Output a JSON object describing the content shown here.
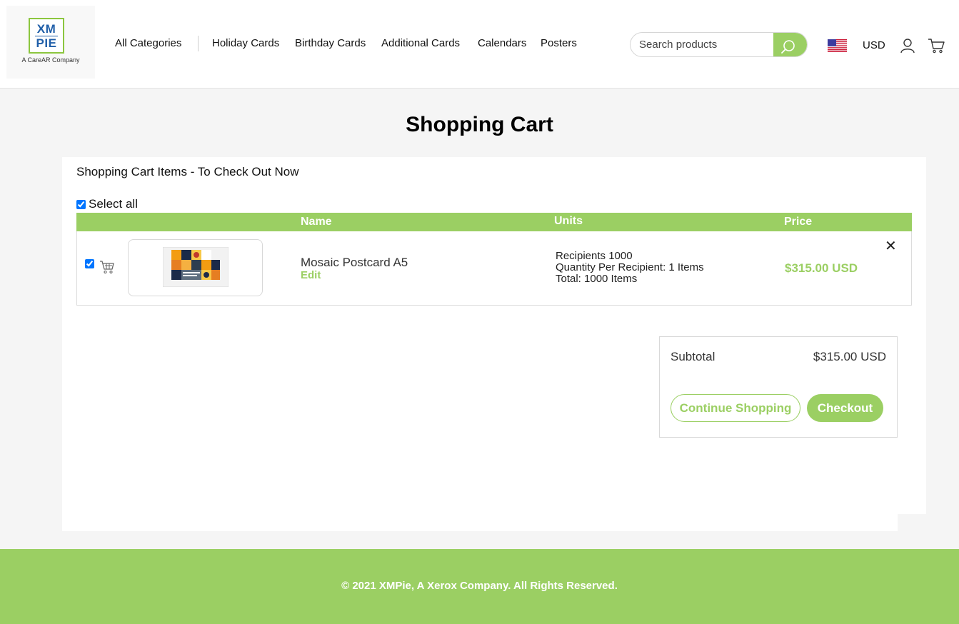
{
  "brand": {
    "logo_top": "XM",
    "logo_bottom": "PIE",
    "logo_tagline": "A CareAR Company"
  },
  "nav": {
    "items": [
      {
        "label": "All Categories"
      },
      {
        "label": "Holiday Cards"
      },
      {
        "label": "Birthday Cards"
      },
      {
        "label": "Additional Cards"
      },
      {
        "label": "Calendars"
      },
      {
        "label": "Posters"
      }
    ]
  },
  "search": {
    "placeholder": "Search products",
    "icon": "search-icon"
  },
  "locale": {
    "flag_icon": "us-flag-icon",
    "currency": "USD"
  },
  "icons": {
    "user": "user-icon",
    "cart": "cart-icon",
    "remove": "close-icon"
  },
  "page": {
    "title": "Shopping Cart"
  },
  "cart": {
    "section_title": "Shopping Cart Items - To Check Out Now",
    "select_all_label": "Select all",
    "select_all_checked": true,
    "columns": {
      "name": "Name",
      "units": "Units",
      "price": "Price"
    },
    "items": [
      {
        "checked": true,
        "name": "Mosaic Postcard A5",
        "edit_label": "Edit",
        "units": {
          "recipients": "Recipients 1000",
          "quantity": "Quantity Per Recipient: 1 Items",
          "total": "Total: 1000 Items"
        },
        "price": "$315.00 USD",
        "remove_glyph": "✕"
      }
    ]
  },
  "summary": {
    "subtotal_label": "Subtotal",
    "subtotal_value": "$315.00 USD",
    "continue_label": "Continue Shopping",
    "checkout_label": "Checkout"
  },
  "footer": {
    "text": "© 2021 XMPie, A Xerox Company. All Rights Reserved."
  },
  "colors": {
    "accent": "#9bcf63",
    "brand_blue": "#1f5ea8"
  }
}
